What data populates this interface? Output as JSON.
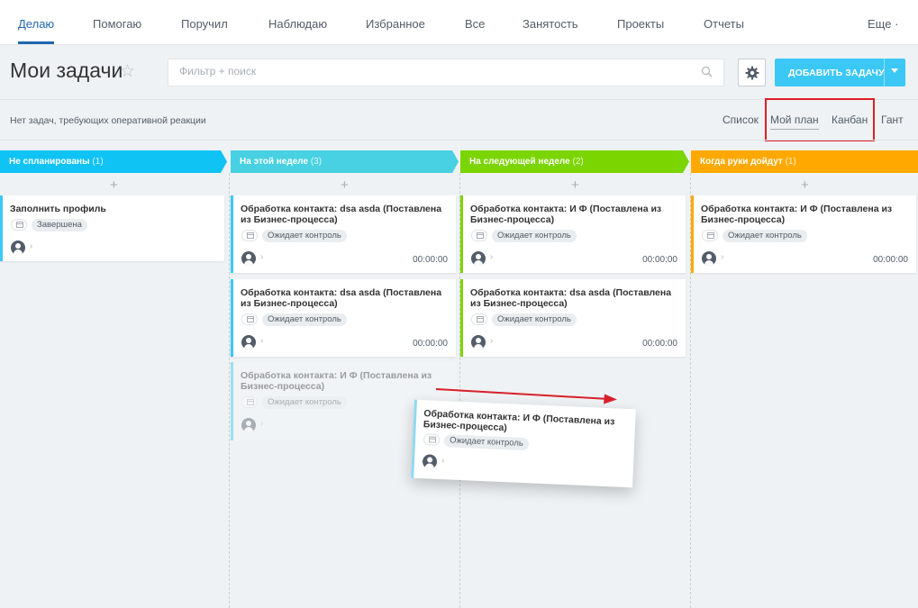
{
  "nav": {
    "items": [
      "Делаю",
      "Помогаю",
      "Поручил",
      "Наблюдаю",
      "Избранное",
      "Все",
      "Занятость",
      "Проекты",
      "Отчеты"
    ],
    "more": "Еще ·"
  },
  "header": {
    "title": "Мои задачи",
    "search_placeholder": "Фильтр + поиск",
    "add_button": "ДОБАВИТЬ ЗАДАЧУ"
  },
  "notice": "Нет задач, требующих оперативной реакции",
  "views": [
    "Список",
    "Мой план",
    "Канбан",
    "Гант"
  ],
  "active_view": "Мой план",
  "columns": [
    {
      "title": "Не спланированы",
      "count": "(1)",
      "color": "#10c3f5"
    },
    {
      "title": "На этой неделе",
      "count": "(3)",
      "color": "#47d1e2"
    },
    {
      "title": "На следующей неделе",
      "count": "(2)",
      "color": "#7bd500"
    },
    {
      "title": "Когда руки дойдут",
      "count": "(1)",
      "color": "#ffa900"
    }
  ],
  "cards": {
    "c1": {
      "title": "Заполнить профиль",
      "status": "Завершена"
    },
    "c2": {
      "title": "Обработка контакта: dsa asda (Поставлена из Бизнес-процесса)",
      "status": "Ожидает контроль",
      "time": "00:00:00"
    },
    "c3": {
      "title": "Обработка контакта: dsa asda (Поставлена из Бизнес-процесса)",
      "status": "Ожидает контроль",
      "time": "00:00:00"
    },
    "c4": {
      "title": "Обработка контакта: И Ф (Поставлена из Бизнес-процесса)",
      "status": "Ожидает контроль"
    },
    "c5": {
      "title": "Обработка контакта: И Ф (Поставлена из Бизнес-процесса)",
      "status": "Ожидает контроль",
      "time": "00:00:00"
    },
    "c6": {
      "title": "Обработка контакта: dsa asda (Поставлена из Бизнес-процесса)",
      "status": "Ожидает контроль",
      "time": "00:00:00"
    },
    "c7": {
      "title": "Обработка контакта: И Ф (Поставлена из Бизнес-процесса)",
      "status": "Ожидает контроль",
      "time": "00:00:00"
    },
    "drag": {
      "title": "Обработка контакта: И Ф (Поставлена из Бизнес-процесса)",
      "status": "Ожидает контроль"
    }
  },
  "colors": {
    "accent": "#2067b0",
    "add_button": "#3bc8f5",
    "highlight": "#e01e26",
    "arrow": "#d8202a"
  }
}
